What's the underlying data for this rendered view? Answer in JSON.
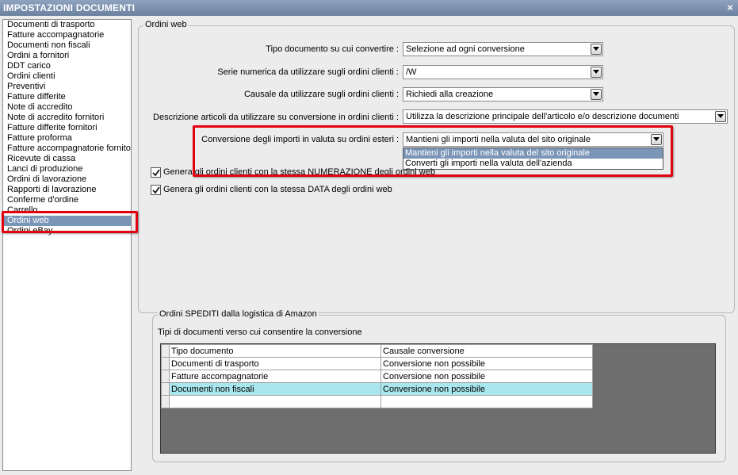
{
  "window": {
    "title": "IMPOSTAZIONI DOCUMENTI",
    "close_glyph": "×"
  },
  "sidebar": {
    "items": [
      "Documenti di trasporto",
      "Fatture accompagnatorie",
      "Documenti non fiscali",
      "Ordini a fornitori",
      "DDT carico",
      "Ordini clienti",
      "Preventivi",
      "Fatture differite",
      "Note di accredito",
      "Note di accredito fornitori",
      "Fatture differite fornitori",
      "Fatture proforma",
      "Fatture accompagnatorie fornito",
      "Ricevute di cassa",
      "Lanci di produzione",
      "Ordini di lavorazione",
      "Rapporti di lavorazione",
      "Conferme d'ordine",
      "Carrello",
      "Ordini web",
      "Ordini eBay"
    ],
    "selected_index": 19
  },
  "web_orders": {
    "group_title": "Ordini web",
    "fields": [
      {
        "label": "Tipo documento su cui convertire :",
        "value": "Selezione ad ogni conversione"
      },
      {
        "label": "Serie numerica da utilizzare sugli ordini clienti :",
        "value": "/W"
      },
      {
        "label": "Causale da utilizzare sugli ordini clienti :",
        "value": "Richiedi alla creazione"
      },
      {
        "label": "Descrizione articoli da utilizzare su conversione in ordini clienti :",
        "value": "Utilizza la descrizione principale dell'articolo e/o descrizione documenti"
      },
      {
        "label": "Conversione degli importi in valuta su ordini esteri :",
        "value": "Mantieni gli importi nella valuta del sito originale"
      }
    ],
    "currency_options": [
      "Mantieni gli importi nella valuta del sito originale",
      "Converti gli importi nella valuta dell'azienda"
    ],
    "currency_selected_index": 0,
    "checkboxes": [
      {
        "label": "Genera gli ordini clienti con la stessa NUMERAZIONE degli ordini web",
        "checked": true
      },
      {
        "label": "Genera gli ordini clienti con la stessa DATA degli ordini web",
        "checked": true
      }
    ]
  },
  "amazon": {
    "group_title": "Ordini SPEDITI dalla logistica di Amazon",
    "subtitle": "Tipi di documenti verso cui consentire la conversione",
    "columns": [
      "Tipo documento",
      "Causale conversione"
    ],
    "rows": [
      [
        "Documenti di trasporto",
        "Conversione non possibile"
      ],
      [
        "Fatture accompagnatorie",
        "Conversione non possibile"
      ],
      [
        "Documenti non fiscali",
        "Conversione non possibile"
      ],
      [
        "",
        ""
      ]
    ],
    "highlighted_row": 2
  },
  "colors": {
    "selection": "#7b95b7",
    "highlight_row": "#a9e7ee",
    "callout": "#e3000f"
  }
}
